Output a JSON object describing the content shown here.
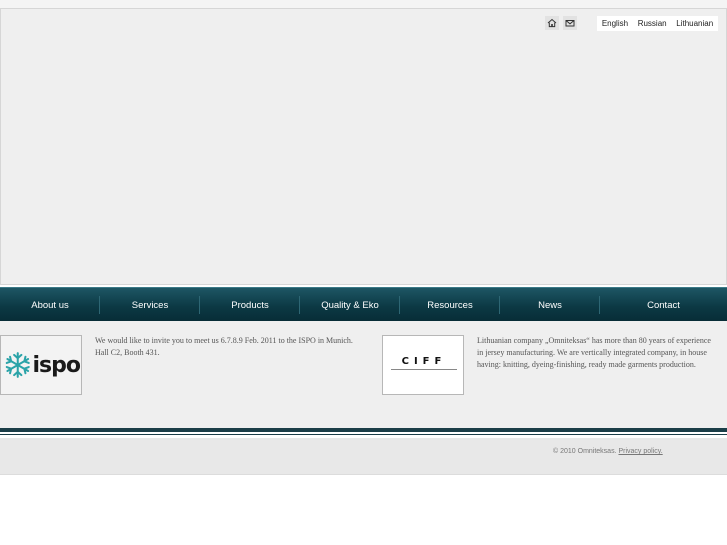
{
  "header": {
    "icons": [
      "home-icon",
      "mail-icon"
    ],
    "languages": [
      "English",
      "Russian",
      "Lithuanian"
    ]
  },
  "nav": {
    "items": [
      "About us",
      "Services",
      "Products",
      "Quality & Eko",
      "Resources",
      "News",
      "Contact"
    ]
  },
  "content": {
    "left": {
      "logo_text": "ispo",
      "text": "We would like to invite you to meet us 6.7.8.9 Feb. 2011 to the ISPO in Munich. Hall C2, Booth 431."
    },
    "right": {
      "logo_text": "CIFF",
      "text": "Lithuanian company „Omniteksas“ has more than 80 years of experience in jersey manufacturing. We are vertically integrated company, in house having: knitting, dyeing-finishing, ready made garments production."
    }
  },
  "footer": {
    "copyright": "© 2010 Omniteksas. ",
    "privacy_link": "Privacy policy."
  },
  "colors": {
    "nav_dark": "#0c3944",
    "nav_light": "#1d5664",
    "rule": "#1b3e48",
    "ispo_snowflake": "#2aa3a8"
  }
}
